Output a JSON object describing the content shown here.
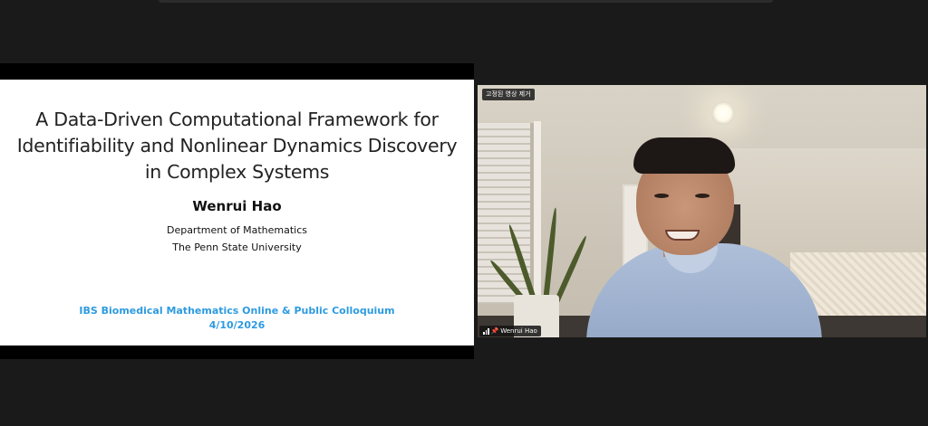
{
  "slide": {
    "title_line1": "A Data-Driven Computational Framework for",
    "title_line2": "Identifiability and Nonlinear Dynamics Discovery",
    "title_line3": "in Complex Systems",
    "author": "Wenrui Hao",
    "department": "Department of Mathematics",
    "university": "The Penn State University",
    "event": "IBS Biomedical Mathematics Online & Public Colloquium",
    "date": "4/10/2026"
  },
  "video": {
    "pinned_button_label": "고정된 영상 제거",
    "participant_name": "Wenrui Hao",
    "icons": [
      "signal-icon",
      "pin-icon"
    ]
  },
  "colors": {
    "background": "#1a1a1a",
    "slide_accent": "#2d9be0"
  }
}
